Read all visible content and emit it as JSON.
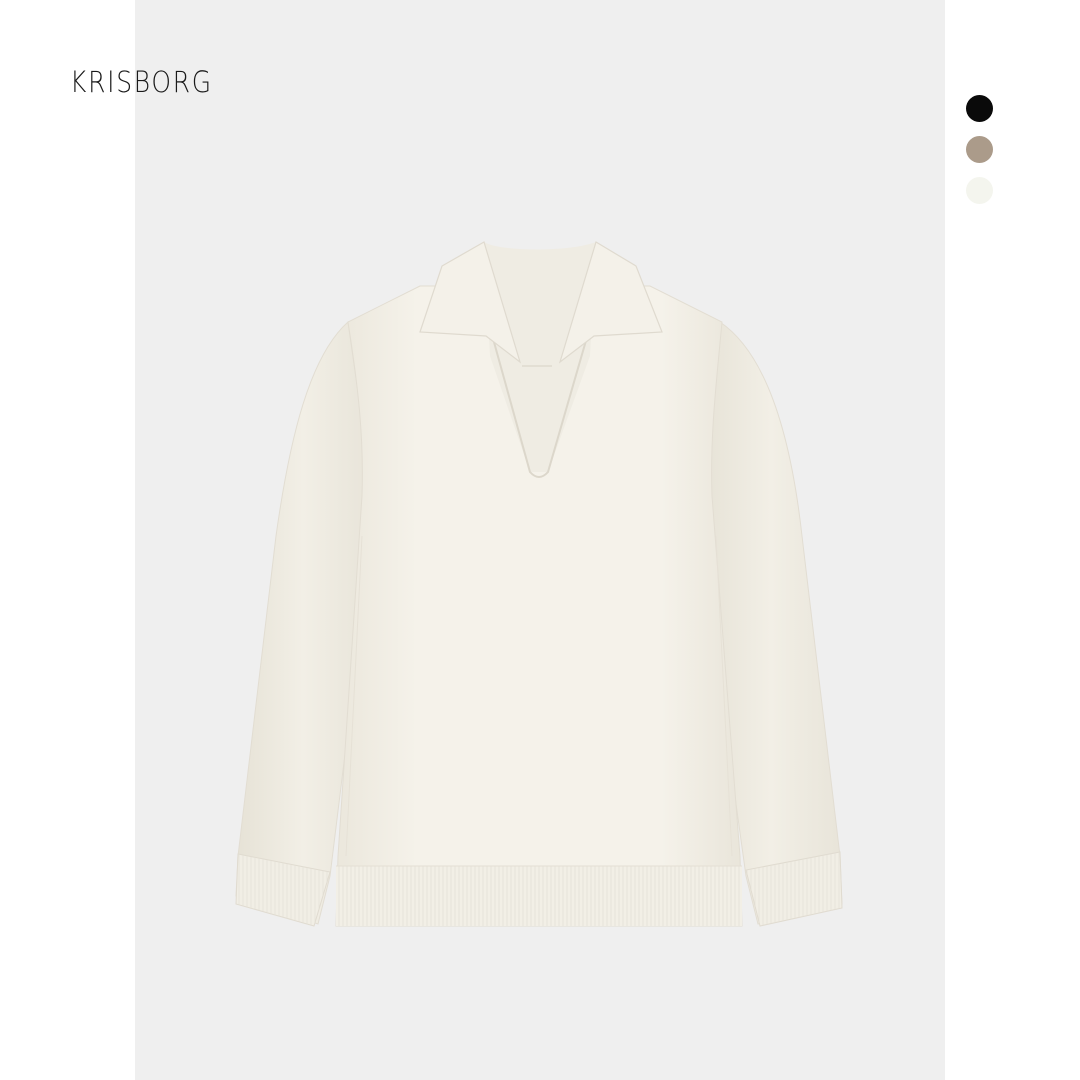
{
  "brand": {
    "name": "KRISBORG"
  },
  "product": {
    "image": "cream-knit-polo-collar-v-neck-sweater",
    "color": "#f3f0e8"
  },
  "color_options": [
    {
      "name": "black",
      "hex": "#0a0a0a"
    },
    {
      "name": "taupe",
      "hex": "#ab9b8a"
    },
    {
      "name": "cream",
      "hex": "#f4f5ee"
    }
  ],
  "colors": {
    "page_background": "#ffffff",
    "photo_background": "#efefef"
  }
}
